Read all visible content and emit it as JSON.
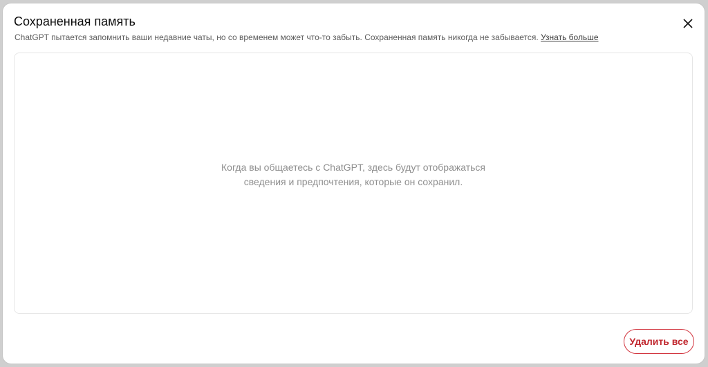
{
  "modal": {
    "title": "Сохраненная память",
    "close_icon": "close-icon",
    "description": "ChatGPT пытается запомнить ваши недавние чаты, но со временем может что-то забыть. Сохраненная память никогда не забывается.",
    "learn_more_link": "Узнать больше"
  },
  "memory_panel": {
    "empty_line1": "Когда вы общаетесь с ChatGPT, здесь будут отображаться",
    "empty_line2": "сведения и предпочтения, которые он сохранил."
  },
  "footer": {
    "delete_all_label": "Удалить все"
  },
  "colors": {
    "danger": "#c0262d",
    "muted_text": "#8f8f8f",
    "border": "#e6e6e6"
  }
}
